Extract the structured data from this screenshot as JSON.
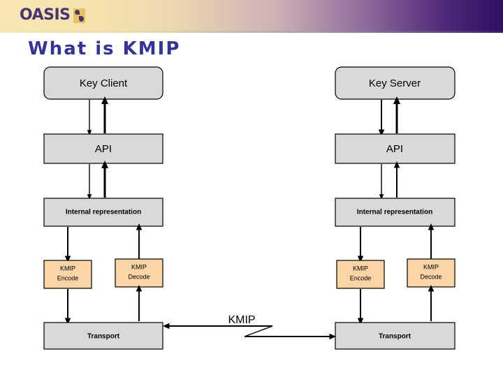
{
  "banner": {
    "logo_text": "OASIS",
    "logo_mark": "oasis-logo-mark"
  },
  "title": "What is KMIP",
  "diagram": {
    "protocol_label": "KMIP",
    "left": {
      "endpoint": "Key Client",
      "api": "API",
      "internal": "Internal representation",
      "encode_line1": "KMIP",
      "encode_line2": "Encode",
      "decode_line1": "KMIP",
      "decode_line2": "Decode",
      "transport": "Transport"
    },
    "right": {
      "endpoint": "Key Server",
      "api": "API",
      "internal": "Internal representation",
      "encode_line1": "KMIP",
      "encode_line2": "Encode",
      "decode_line1": "KMIP",
      "decode_line2": "Decode",
      "transport": "Transport"
    }
  },
  "colors": {
    "title": "#333399",
    "logo": "#4a3370",
    "logo_mark": "#e3c364",
    "box_fill": "#d9d9d9",
    "codec_fill": "#fbd5a5",
    "stroke": "#000000",
    "banner_start": "#f7e7b4",
    "banner_end": "#2e0f63"
  }
}
